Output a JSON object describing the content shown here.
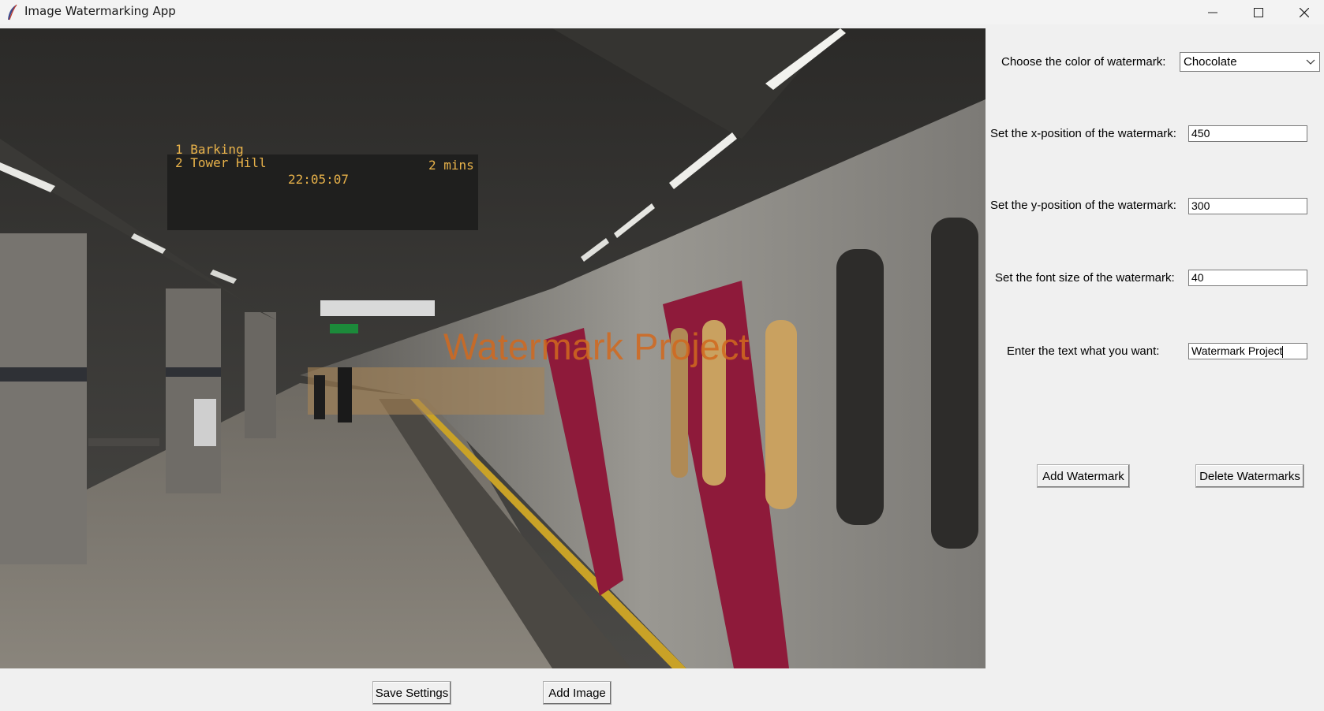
{
  "window": {
    "title": "Image Watermarking App",
    "icon": "feather-icon"
  },
  "image": {
    "description_icon": "photo-canvas",
    "board": {
      "line1": "1  Barking",
      "line2": "2  Tower Hill",
      "time": "22:05:07",
      "mins": "2 mins"
    },
    "watermark_text": "Watermark Project",
    "watermark_color": "#d2691e"
  },
  "controls": {
    "color_label": "Choose the color of watermark:",
    "color_value": "Chocolate",
    "x_label": "Set the x-position of the watermark:",
    "x_value": "450",
    "y_label": "Set the y-position of the watermark:",
    "y_value": "300",
    "font_label": "Set the font size of the watermark:",
    "font_value": "40",
    "text_label": "Enter the text what you want:",
    "text_value": "Watermark Project",
    "add_watermark": "Add Watermark",
    "delete_watermarks": "Delete Watermarks"
  },
  "bottom": {
    "save_settings": "Save Settings",
    "add_image": "Add Image"
  }
}
